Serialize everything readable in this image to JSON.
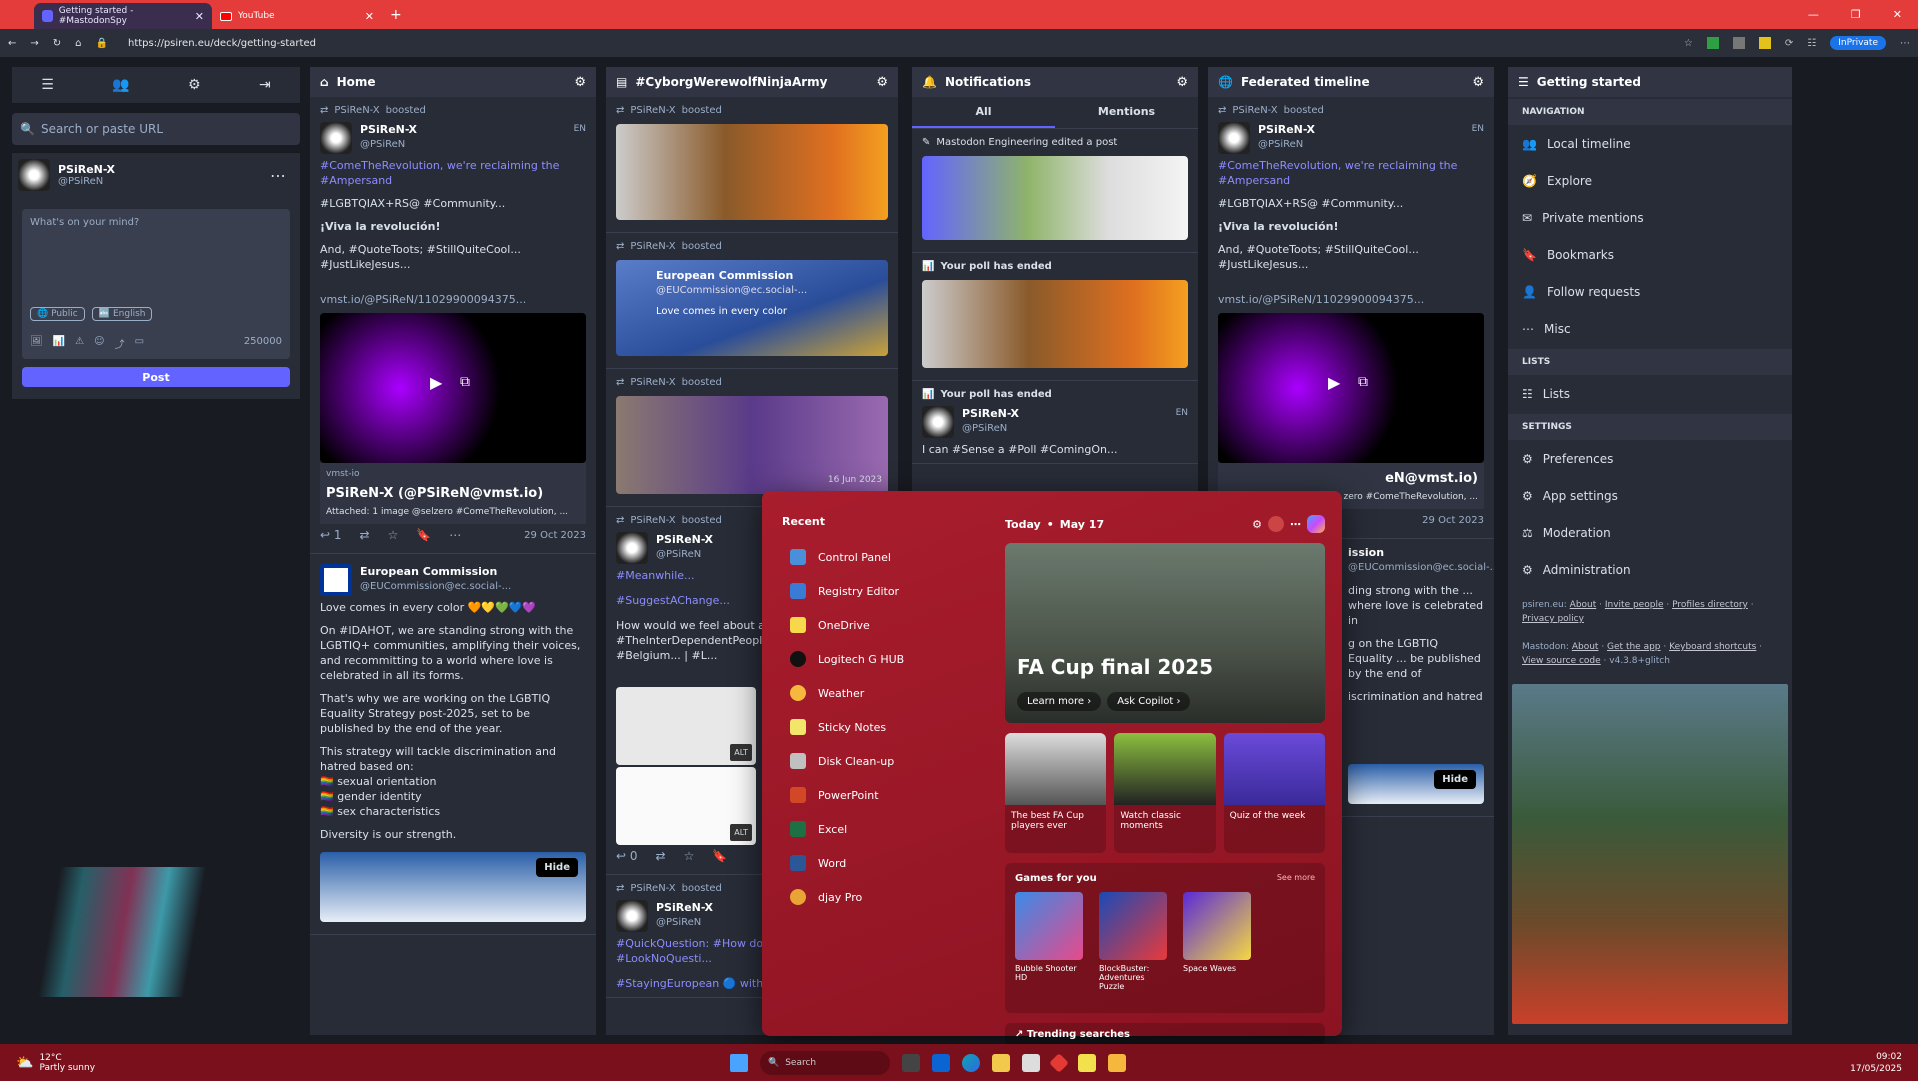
{
  "browser": {
    "tabs": [
      {
        "label": "Getting started - #MastodonSpy"
      },
      {
        "label": "YouTube"
      }
    ],
    "url": "https://psiren.eu/deck/getting-started",
    "inprivate": "InPrivate"
  },
  "compose": {
    "search_placeholder": "Search or paste URL",
    "profile_name": "PSiReN-X",
    "profile_handle": "@PSiReN",
    "placeholder": "What's on your mind?",
    "visibility": "Public",
    "language": "English",
    "char_count": "250000",
    "post_label": "Post"
  },
  "home": {
    "title": "Home",
    "boost_line": "PSiReN-X",
    "boosted": "boosted",
    "author": "PSiReN-X",
    "handle": "@PSiReN",
    "lang": "EN",
    "text1": "#ComeTheRevolution, we're reclaiming the #Ampersand",
    "text2": "#LGBTQIAX+RS@ #Community...",
    "text3": "¡Viva la revolución!",
    "text4": "And, #QuoteToots; #StillQuiteCool... #JustLikeJesus...",
    "link": "vmst.io/@PSiReN/11029900094375...",
    "card_domain": "vmst-io",
    "card_title": "PSiReN-X (@PSiReN@vmst.io)",
    "card_desc": "Attached: 1 image @selzero #ComeTheRevolution, ...",
    "reply_count": "1",
    "date": "29 Oct 2023",
    "post2_author": "European Commission",
    "post2_handle": "@EUCommission@ec.social-...",
    "post2_text1": "Love comes in every color 🧡💛💚💙💜",
    "post2_text2": "On #IDAHOT, we are standing strong with the LGBTIQ+ communities, amplifying their voices, and recommitting to a world where love is celebrated in all its forms.",
    "post2_text3": "That's why we are working on the LGBTIQ Equality Strategy post-2025, set to be published by the end of the year.",
    "post2_text4": "This strategy will tackle discrimination and hatred based on:",
    "post2_list": [
      "sexual orientation",
      "gender identity",
      "sex characteristics"
    ],
    "post2_text5": "Diversity is our strength.",
    "hide": "Hide"
  },
  "hashtag": {
    "title": "#CyborgWerewolfNinjaArmy",
    "author": "PSiReN-X",
    "boosted": "boosted",
    "handle": "@PSiReN",
    "eu_name": "European Commission",
    "eu_handle": "@EUCommission@ec.social-...",
    "eu_text": "Love comes in every color",
    "post3_date": "16 Jun 2023",
    "text_a": "#Meanwhile...",
    "text_b": "#SuggestAChange...",
    "text_c": "How would we feel about a ... connecting #TheInterDependentPeoplesOf... fKent... With #Belgium... | #L...",
    "alt": "ALT",
    "reply_count": "0",
    "text_d": "#QuickQuestion: #How do yo... #InSpace...! | #LookNoQuesti...",
    "text_e": "#StayingEuropean 🔵 with #I..."
  },
  "notifications": {
    "title": "Notifications",
    "tab_all": "All",
    "tab_mentions": "Mentions",
    "edited": "Mastodon Engineering edited a post",
    "poll1": "Your poll has ended",
    "poll2": "Your poll has ended",
    "author": "PSiReN-X",
    "handle": "@PSiReN",
    "lang": "EN",
    "text": "I can #Sense a #Poll #ComingOn..."
  },
  "federated": {
    "title": "Federated timeline",
    "author": "PSiReN-X",
    "boosted": "boosted",
    "handle": "@PSiReN",
    "lang": "EN",
    "text1": "#ComeTheRevolution, we're reclaiming the #Ampersand",
    "text2": "#LGBTQIAX+RS@ #Community...",
    "text3": "¡Viva la revolución!",
    "text4": "And, #QuoteToots; #StillQuiteCool... #JustLikeJesus...",
    "link": "vmst.io/@PSiReN/11029900094375...",
    "card_title": "eN@vmst.io)",
    "card_desc": "zero #ComeTheRevolution, ...",
    "date": "29 Oct 2023",
    "post2_author": "ission",
    "post2_handle": "@EUCommission@ec.social-...",
    "post2_text": "ding strong with the ... where love is celebrated in",
    "post2_text2": "g on the LGBTIQ Equality ... be published by the end of",
    "post2_text3": "iscrimination and hatred",
    "hide": "Hide"
  },
  "getting_started": {
    "title": "Getting started",
    "sections": [
      {
        "label": "NAVIGATION"
      },
      {
        "label": "LISTS"
      },
      {
        "label": "SETTINGS"
      }
    ],
    "nav": [
      "Local timeline",
      "Explore",
      "Private mentions",
      "Bookmarks",
      "Follow requests",
      "Misc"
    ],
    "lists": [
      "Lists"
    ],
    "settings": [
      "Preferences",
      "App settings",
      "Moderation",
      "Administration"
    ],
    "footer1_prefix": "psiren.eu:",
    "footer1_links": [
      "About",
      "Invite people",
      "Profiles directory",
      "Privacy policy"
    ],
    "footer2_prefix": "Mastodon:",
    "footer2_links": [
      "About",
      "Get the app",
      "Keyboard shortcuts",
      "View source code"
    ],
    "version": "v4.3.8+glitch"
  },
  "startmenu": {
    "recent_title": "Recent",
    "apps": [
      "Control Panel",
      "Registry Editor",
      "OneDrive",
      "Logitech G HUB",
      "Weather",
      "Sticky Notes",
      "Disk Clean-up",
      "PowerPoint",
      "Excel",
      "Word",
      "djay Pro"
    ],
    "feed_date_label": "Today",
    "feed_date": "May 17",
    "hero_title": "FA Cup final 2025",
    "learn_more": "Learn more",
    "ask_copilot": "Ask Copilot",
    "cards": [
      "The best FA Cup players ever",
      "Watch classic moments",
      "Quiz of the week"
    ],
    "games_title": "Games for you",
    "see_more": "See more",
    "games": [
      "Bubble Shooter HD",
      "BlockBuster: Adventures Puzzle",
      "Space Waves"
    ],
    "trending": "Trending searches"
  },
  "taskbar": {
    "temp": "12°C",
    "condition": "Partly sunny",
    "search": "Search",
    "time": "09:02",
    "date": "17/05/2025"
  }
}
